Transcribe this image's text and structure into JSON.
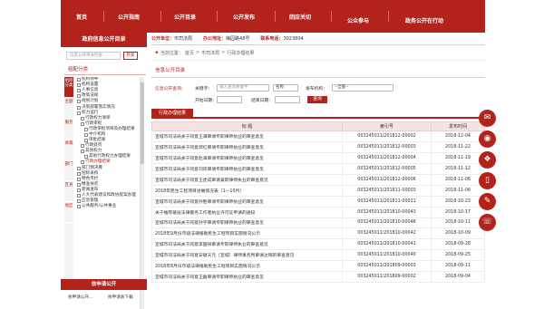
{
  "nav": {
    "items": [
      "首页",
      "公开指南",
      "公开目录",
      "公开发布",
      "回应关切",
      "公众参与",
      "政务公开在行动"
    ]
  },
  "left": {
    "title": "政府信息公开目录",
    "search_placeholder": "信息公开目录检索",
    "search_button": "检索",
    "category_label": "组配分类",
    "vtabs": [
      "组织分类",
      "主题",
      "服务",
      "体裁",
      "部门",
      "区县",
      "地区"
    ],
    "tree": [
      "机构领导",
      "机构设置",
      "人事信息",
      "政策法规",
      "规划计划",
      "决策部署落实情况",
      "权力运行",
      "行政权力清单",
      "行政审批",
      "行政审批项目及办理结果",
      "中介机构",
      "审批结果",
      "行政处罚",
      "其他权力",
      "其他行政权力办理结果",
      "行政办理结果",
      "部门预决算",
      "招标采购",
      "特色专栏",
      "精准扶贫",
      "新闻发布",
      "人大代表建议和政协提案办理",
      "应急管理",
      "公共服务/公共事业"
    ],
    "apply_title": "依申请公开",
    "apply_links": [
      "依申请公开...",
      "依申请表下载"
    ]
  },
  "info": {
    "unit_label": "公开单位：",
    "unit": "市司法局",
    "addr_label": "办公地址：",
    "addr": "梅园路48号",
    "phone_label": "联系电话：",
    "phone": "3023804"
  },
  "crumb": {
    "prefix": "当前位置：",
    "path": [
      "首页",
      "市司法局",
      "行政办理结果"
    ]
  },
  "section_title": "信息公开目录",
  "query": {
    "label": "信息公开查询：",
    "keyword_label": "关键字：",
    "keyword_placeholder": "输入查询关键字",
    "field": "名称",
    "org_label": "发布机构：",
    "org_value": "--全部--",
    "start_label": "开始日期：",
    "end_label": "结束日期：",
    "button": "查询"
  },
  "tab": "行政办理结果",
  "table": {
    "headers": [
      "标  题",
      "索引号",
      "发布时间"
    ],
    "rows": [
      [
        "宣城市司法局关于同意王满审请专职律师执业的审查意见",
        "003245011/201812-00002",
        "2018-12-04"
      ],
      [
        "宣城市司法局关于同意郭红审请专职律师执业的审查意见",
        "003245011/201812-00003",
        "2018-11-22"
      ],
      [
        "宣城市司法局关于同意赵海审请专职律师执业的审查意见",
        "003245011/201812-00004",
        "2018-11-19"
      ],
      [
        "宣城市司法局关于同意刘凤审请专职律师执业的审查意见",
        "003245011/201812-00005",
        "2018-11-12"
      ],
      [
        "宣城市司法局关于同意王虎成审请兼职律师执业的审查意见",
        "003245011/201812-00006",
        "2018-11-06"
      ],
      [
        "2018年民生工程项目进展情况表（1—10月）",
        "003245011/201811-00003",
        "2018-11-06"
      ],
      [
        "宣城市司法局关于同意孙胜审请专职律师执业的审查意见",
        "003245011/201811-00021",
        "2018-10-23"
      ],
      [
        "关于推荐基层法律服务工作者执业许可证申请的通知",
        "003245011/201810-00043",
        "2018-10-17"
      ],
      [
        "宣城市司法局关于同意孙宇审请专职律师执业的审查意见",
        "003245011/201810-00048",
        "2018-10-11"
      ],
      [
        "2018年9月份市级法律援助民生工程项目实施情况公示",
        "003245011/201810-00042",
        "2018-10-09"
      ],
      [
        "宣城市司法局关于同意李国祥审请专职律师执业的审查意见",
        "003245011/201810-00041",
        "2018-09-28"
      ],
      [
        "宣城市司法局关于同意安徽天元（宣城）律师事务所审请注销的审查意见",
        "003245011/201810-00040",
        "2018-09-25"
      ],
      [
        "2018年8月份市级法律援助民生工程项目实施情况公示",
        "003245011/201809-00003",
        "2018-09-11"
      ],
      [
        "宣城市司法局关于同意王磊审请专职律师执业的审查意见",
        "003245011/201809-00002",
        "2018-09-04"
      ]
    ]
  },
  "float_icons": [
    "email-icon",
    "weibo-icon",
    "wechat-icon",
    "mobile-icon",
    "chat-icon",
    "phone-icon"
  ],
  "colors": {
    "brand": "#b3231c"
  }
}
